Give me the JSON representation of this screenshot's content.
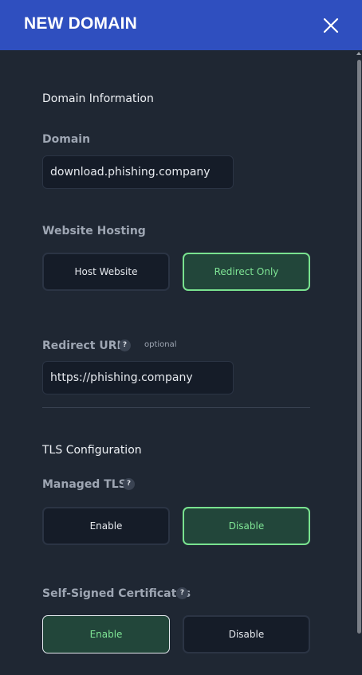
{
  "header": {
    "title": "NEW DOMAIN",
    "close_icon": "close-icon"
  },
  "domain_info": {
    "section_title": "Domain Information",
    "domain_label": "Domain",
    "domain_value": "download.phishing.company"
  },
  "hosting": {
    "label": "Website Hosting",
    "options": [
      {
        "label": "Host Website",
        "selected": false
      },
      {
        "label": "Redirect Only",
        "selected": true
      }
    ]
  },
  "redirect": {
    "label": "Redirect URL",
    "help": "?",
    "optional": "optional",
    "value": "https://phishing.company"
  },
  "tls": {
    "section_title": "TLS Configuration",
    "managed_label": "Managed TLS",
    "managed_help": "?",
    "managed_options": [
      {
        "label": "Enable",
        "selected": false
      },
      {
        "label": "Disable",
        "selected": true
      }
    ],
    "selfsigned_label": "Self-Signed Certificates",
    "selfsigned_help": "?",
    "selfsigned_options": [
      {
        "label": "Enable",
        "selected": true
      },
      {
        "label": "Disable",
        "selected": false
      }
    ]
  },
  "colors": {
    "header_bg": "#2f4fbf",
    "panel_bg": "#1f2733",
    "accent_green": "#79e28f"
  }
}
